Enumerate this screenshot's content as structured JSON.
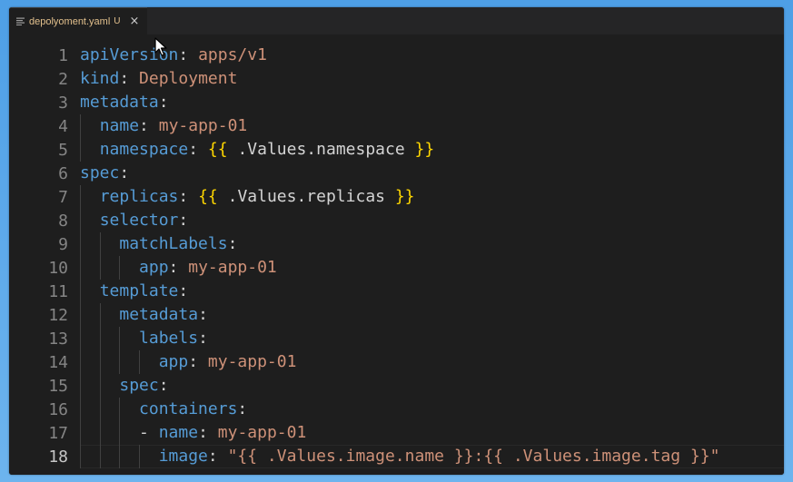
{
  "tab": {
    "icon": "lines-icon",
    "filename": "depolyoment.yaml",
    "status": "U",
    "close": "×"
  },
  "colors": {
    "key": "#569cd6",
    "string": "#ce9178",
    "bracket": "#ffd700",
    "punct": "#d4d4d4",
    "background": "#1e1e1e",
    "line_number": "#858585"
  },
  "lines": [
    {
      "n": "1",
      "indent": "",
      "key": "apiVersion",
      "sep": ": ",
      "value": "apps/v1"
    },
    {
      "n": "2",
      "indent": "",
      "key": "kind",
      "sep": ": ",
      "value": "Deployment"
    },
    {
      "n": "3",
      "indent": "",
      "key": "metadata",
      "sep": ":",
      "value": ""
    },
    {
      "n": "4",
      "indent": "  ",
      "key": "name",
      "sep": ": ",
      "value": "my-app-01"
    },
    {
      "n": "5",
      "indent": "  ",
      "key": "namespace",
      "sep": ": ",
      "open": "{{",
      "expr": " .Values.namespace ",
      "close": "}}"
    },
    {
      "n": "6",
      "indent": "",
      "key": "spec",
      "sep": ":",
      "value": ""
    },
    {
      "n": "7",
      "indent": "  ",
      "key": "replicas",
      "sep": ": ",
      "open": "{{",
      "expr": " .Values.replicas ",
      "close": "}}"
    },
    {
      "n": "8",
      "indent": "  ",
      "key": "selector",
      "sep": ":",
      "value": ""
    },
    {
      "n": "9",
      "indent": "    ",
      "key": "matchLabels",
      "sep": ":",
      "value": ""
    },
    {
      "n": "10",
      "indent": "      ",
      "key": "app",
      "sep": ": ",
      "value": "my-app-01"
    },
    {
      "n": "11",
      "indent": "  ",
      "key": "template",
      "sep": ":",
      "value": ""
    },
    {
      "n": "12",
      "indent": "    ",
      "key": "metadata",
      "sep": ":",
      "value": ""
    },
    {
      "n": "13",
      "indent": "      ",
      "key": "labels",
      "sep": ":",
      "value": ""
    },
    {
      "n": "14",
      "indent": "        ",
      "key": "app",
      "sep": ": ",
      "value": "my-app-01"
    },
    {
      "n": "15",
      "indent": "    ",
      "key": "spec",
      "sep": ":",
      "value": ""
    },
    {
      "n": "16",
      "indent": "      ",
      "key": "containers",
      "sep": ":",
      "value": ""
    },
    {
      "n": "17",
      "indent": "      ",
      "dash": "- ",
      "key": "name",
      "sep": ": ",
      "value": "my-app-01"
    },
    {
      "n": "18",
      "indent": "        ",
      "key": "image",
      "sep": ": ",
      "value": "\"{{ .Values.image.name }}:{{ .Values.image.tag }}\""
    }
  ],
  "active_line": "18"
}
